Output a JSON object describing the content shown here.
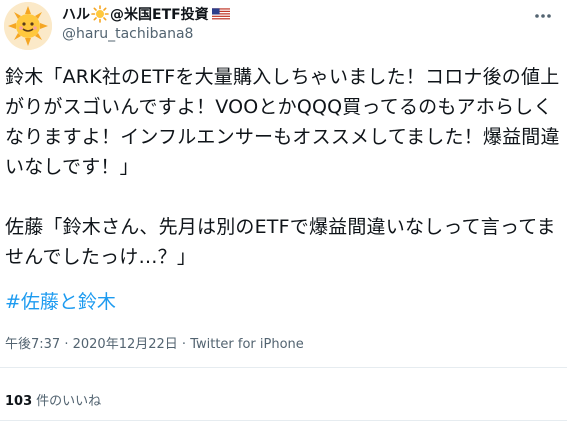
{
  "author": {
    "display_name": "ハル",
    "display_name_suffix": "@米国ETF投資",
    "handle": "@haru_tachibana8",
    "emoji_icons": [
      "sun-icon",
      "us-flag-icon"
    ]
  },
  "tweet": {
    "text": "鈴木「ARK社のETFを大量購入しちゃいました！コロナ後の値上がりがスゴいんですよ！VOOとかQQQ買ってるのもアホらしくなりますよ！インフルエンサーもオススメしてました！爆益間違いなしです！」\n\n佐藤「鈴木さん、先月は別のETFで爆益間違いなしって言ってませんでしたっけ…？」",
    "hashtag": "#佐藤と鈴木",
    "time": "午後7:37",
    "separator": " · ",
    "date": "2020年12月22日",
    "source": "Twitter for iPhone"
  },
  "stats": {
    "likes_count": "103",
    "likes_label": "件のいいね"
  },
  "colors": {
    "link": "#1d9bf0",
    "secondary_text": "#536471",
    "divider": "#e6ecf0"
  }
}
